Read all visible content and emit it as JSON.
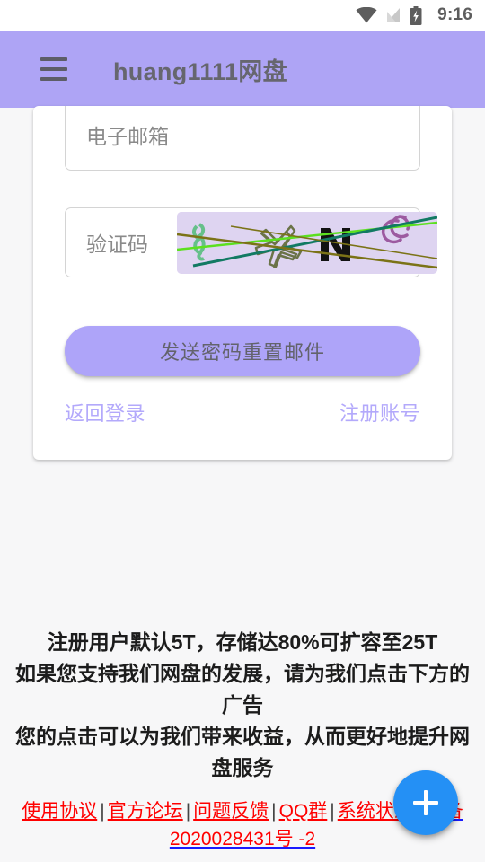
{
  "statusbar": {
    "time": "9:16",
    "icons": [
      "wifi-icon",
      "no-sim-icon",
      "battery-charging-icon"
    ]
  },
  "appbar": {
    "menu_icon": "hamburger-menu-icon",
    "title": "huang1111网盘",
    "background_color": "#aea4f5"
  },
  "form": {
    "email_field": {
      "placeholder": "电子邮箱",
      "value": ""
    },
    "captcha_field": {
      "placeholder": "验证码",
      "value": "",
      "image_alt": "captcha-image",
      "image_background": "#ded4f1"
    },
    "submit_button": {
      "label": "发送密码重置邮件",
      "color": "#aea4f9"
    },
    "links": {
      "back_to_login": "返回登录",
      "register": "注册账号",
      "color": "#b3a9fb"
    }
  },
  "promo": {
    "lines": [
      "注册用户默认5T，存储达80%可扩容至25T",
      "如果您支持我们网盘的发展，请为我们点击下方的广告",
      "您的点击可以为我们带来收益，从而更好地提升网盘服务"
    ]
  },
  "footer": {
    "links": [
      "使用协议",
      "官方论坛",
      "问题反馈",
      "QQ群",
      "系统状态"
    ],
    "separator": "|",
    "icp": "ICP备2020028431号 -2",
    "link_color": "#ff0000",
    "icp_underline_color": "#1a1aff"
  },
  "fab": {
    "icon": "plus-icon",
    "color": "#2490f5"
  }
}
